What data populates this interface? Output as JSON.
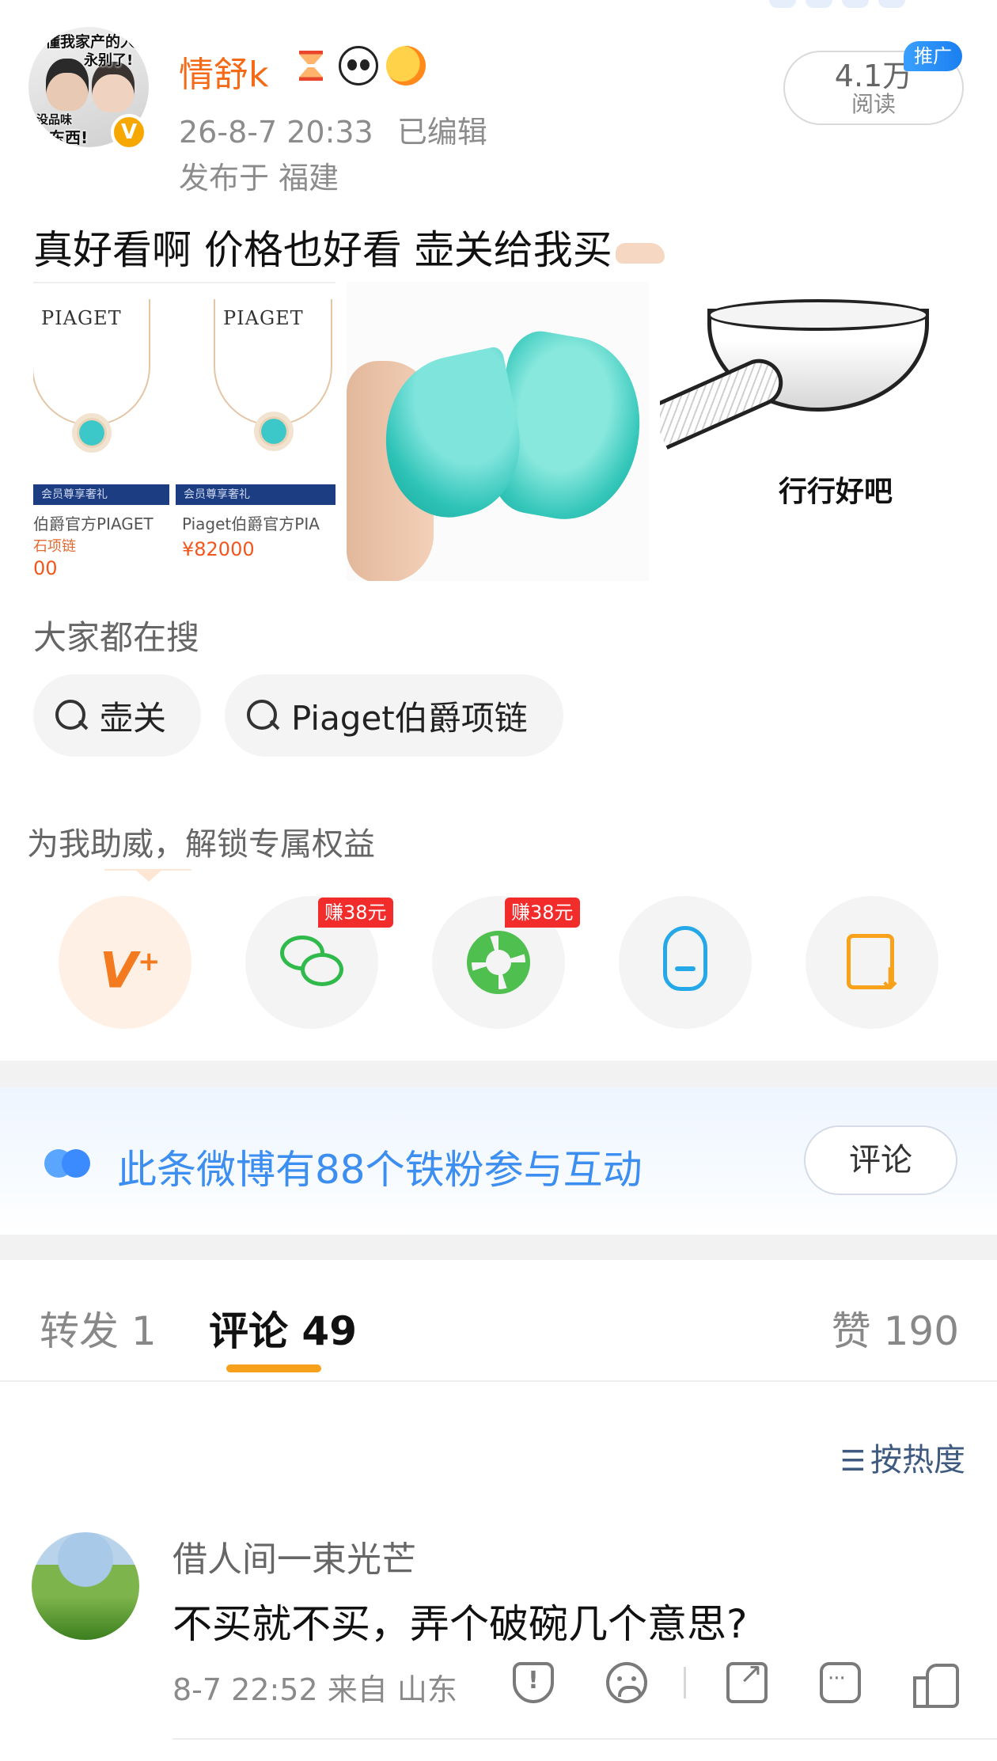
{
  "post": {
    "avatar_caption_top": "不懂我家产的人",
    "avatar_caption_mid": "永别了!",
    "avatar_caption_small": "没品味",
    "avatar_caption_bottom": "の东西!",
    "verified_mark": "V",
    "username": "情舒k",
    "badges": [
      "hourglass-icon",
      "panda-icon",
      "fish-icon"
    ],
    "timestamp": "26-8-7 20:33",
    "edited": "已编辑",
    "location": "发布于 福建",
    "reads": {
      "count": "4.1万",
      "label": "阅读"
    },
    "promo_tag": "推广",
    "text": "真好看啊 价格也好看 壶关给我买"
  },
  "images": {
    "product_brand_1": "PIAGET",
    "product_brand_2": "PIAGET",
    "band_text": "会员尊享奢礼",
    "product1_name": "伯爵官方PIAGET",
    "product1_sub": "石项链",
    "product1_price": "00",
    "product2_name": "Piaget伯爵官方PIA",
    "product2_price": "¥82000",
    "meme_caption": "行行好吧"
  },
  "hot_search": {
    "title": "大家都在搜",
    "items": [
      "壶关",
      "Piaget伯爵项链"
    ]
  },
  "support": {
    "title": "为我助威，解锁专属权益",
    "share_targets": [
      "v-plus-icon",
      "wechat-icon",
      "moments-icon",
      "qq-icon",
      "save-image-icon"
    ],
    "earn_tag_wechat": "赚38元",
    "earn_tag_moments": "赚38元"
  },
  "fans_bar": {
    "text": "此条微博有88个铁粉参与互动",
    "button": "评论"
  },
  "tabs": {
    "repost": "转发 1",
    "comment": "评论 49",
    "like": "赞 190"
  },
  "sort": {
    "label": "按热度"
  },
  "comments": [
    {
      "user": "借人间一束光芒",
      "text": "不买就不买，弄个破碗几个意思?",
      "meta": "8-7 22:52  来自 山东"
    }
  ],
  "colors": {
    "username": "#f46a17",
    "accent_underline": "#f7a01b",
    "fans_blue": "#3d8ef1",
    "earn_red": "#f22b2b"
  }
}
